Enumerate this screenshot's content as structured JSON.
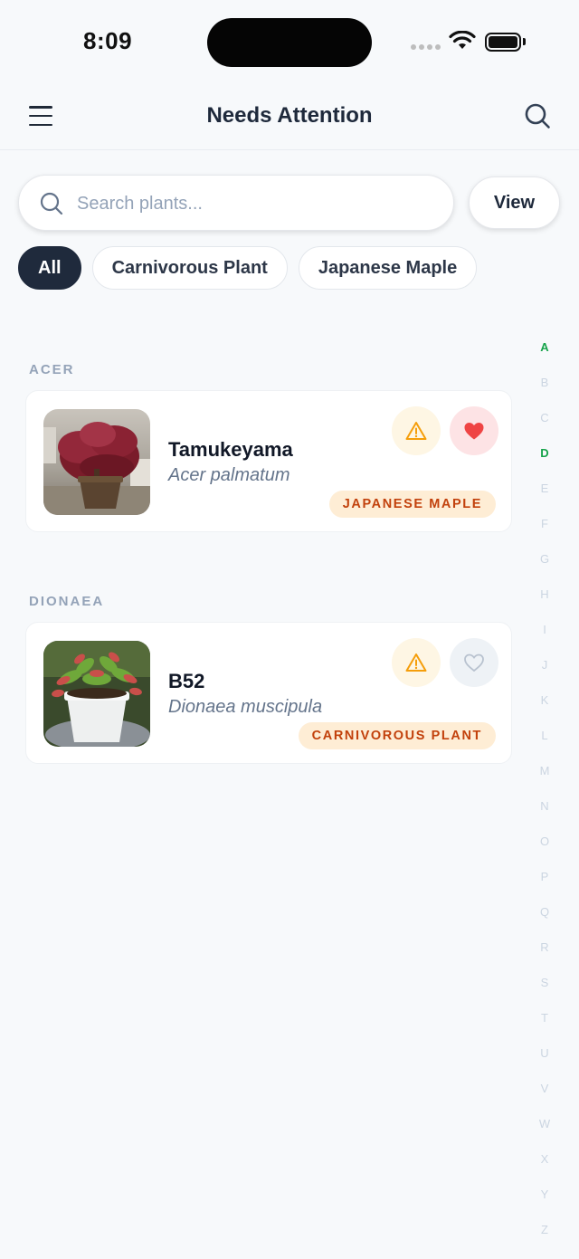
{
  "status_bar": {
    "time": "8:09"
  },
  "header": {
    "title": "Needs Attention"
  },
  "search": {
    "placeholder": "Search plants...",
    "view_label": "View"
  },
  "filters": [
    {
      "label": "All",
      "active": true
    },
    {
      "label": "Carnivorous Plant",
      "active": false
    },
    {
      "label": "Japanese Maple",
      "active": false
    }
  ],
  "sections": [
    {
      "label": "ACER",
      "plants": [
        {
          "name": "Tamukeyama",
          "scientific": "Acer palmatum",
          "tag": "JAPANESE MAPLE",
          "favorite": true,
          "warning": true
        }
      ]
    },
    {
      "label": "DIONAEA",
      "plants": [
        {
          "name": "B52",
          "scientific": "Dionaea muscipula",
          "tag": "CARNIVOROUS PLANT",
          "favorite": false,
          "warning": true
        }
      ]
    }
  ],
  "alphabet": [
    "A",
    "B",
    "C",
    "D",
    "E",
    "F",
    "G",
    "H",
    "I",
    "J",
    "K",
    "L",
    "M",
    "N",
    "O",
    "P",
    "Q",
    "R",
    "S",
    "T",
    "U",
    "V",
    "W",
    "X",
    "Y",
    "Z"
  ],
  "alphabet_active": [
    "A",
    "D"
  ],
  "colors": {
    "accent_green": "#16a34a",
    "chip_active": "#1f2a3c",
    "tag_bg": "#feedd5",
    "tag_text": "#c2410c",
    "warning": "#f59e0b",
    "favorite": "#ef4444"
  }
}
